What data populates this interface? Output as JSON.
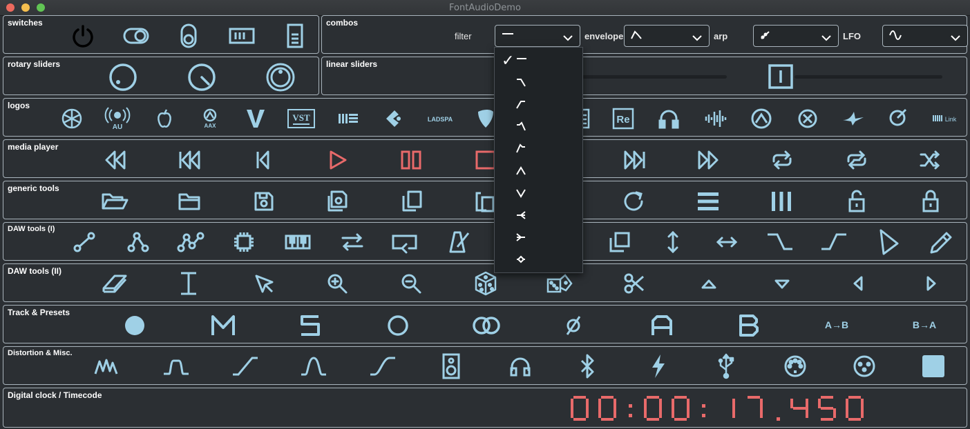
{
  "window": {
    "title": "FontAudioDemo"
  },
  "colors": {
    "icon": "#9fd0e6",
    "accent_red": "#e86a6a",
    "panel_bg": "#2b2f33",
    "border": "#a9b4bc"
  },
  "panels": {
    "switches": "switches",
    "combos": "combos",
    "rotary": "rotary sliders",
    "linear": "linear sliders",
    "logos": "logos",
    "media": "media player",
    "generic": "generic tools",
    "daw1": "DAW tools (I)",
    "daw2": "DAW tools (II)",
    "track": "Track & Presets",
    "distortion": "Distortion & Misc.",
    "clock": "Digital clock / Timecode"
  },
  "combos": {
    "filter_label": "filter",
    "envelope_label": "envelope",
    "arp_label": "arp",
    "lfo_label": "LFO"
  },
  "logos": {
    "ladspa": "LADSPA",
    "link": "Link",
    "vst": "VST",
    "aax": "AAX",
    "au": "AU",
    "re": "Re"
  },
  "track": {
    "m": "M",
    "s": "S",
    "a": "A",
    "b": "B",
    "ab": "A→B",
    "ba": "B→A",
    "phase": "ø"
  },
  "clock": {
    "timecode": "00:00:17.450"
  },
  "dropdown": {
    "selected_index": 0,
    "check": "✓"
  }
}
